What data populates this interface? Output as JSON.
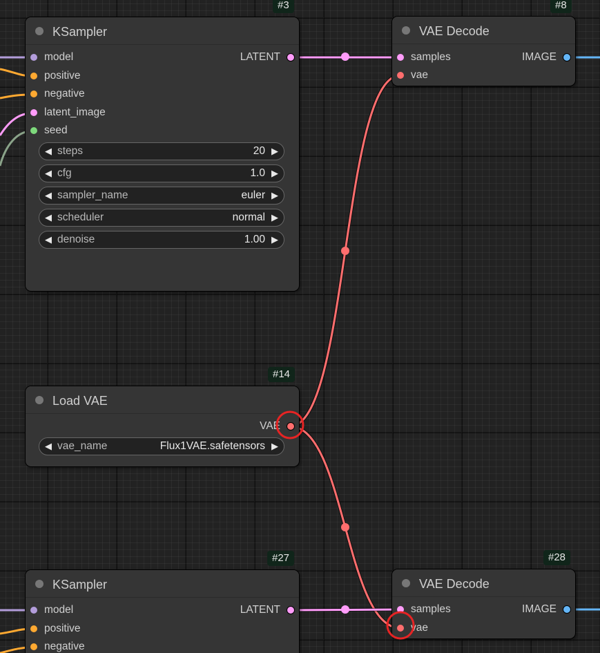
{
  "colors": {
    "background": "#222222",
    "node_body": "#353535",
    "node_id_badge": "#10251a",
    "model": "#b39ddb",
    "conditioning": "#ffa931",
    "latent": "#ff9cf9",
    "int": "#7ed97c",
    "vae": "#ff6e6e",
    "image": "#64b5f6",
    "highlight": "#e62424",
    "seed_link": "#8aa389"
  },
  "nodes": {
    "ksampler_3": {
      "id_label": "#3",
      "title": "KSampler",
      "inputs": [
        {
          "label": "model",
          "type": "MODEL"
        },
        {
          "label": "positive",
          "type": "CONDITIONING"
        },
        {
          "label": "negative",
          "type": "CONDITIONING"
        },
        {
          "label": "latent_image",
          "type": "LATENT"
        },
        {
          "label": "seed",
          "type": "INT"
        }
      ],
      "outputs": [
        {
          "label": "LATENT",
          "type": "LATENT"
        }
      ],
      "widgets": [
        {
          "label": "steps",
          "value": "20"
        },
        {
          "label": "cfg",
          "value": "1.0"
        },
        {
          "label": "sampler_name",
          "value": "euler"
        },
        {
          "label": "scheduler",
          "value": "normal"
        },
        {
          "label": "denoise",
          "value": "1.00"
        }
      ]
    },
    "vae_decode_8": {
      "id_label": "#8",
      "title": "VAE Decode",
      "inputs": [
        {
          "label": "samples",
          "type": "LATENT"
        },
        {
          "label": "vae",
          "type": "VAE"
        }
      ],
      "outputs": [
        {
          "label": "IMAGE",
          "type": "IMAGE"
        }
      ]
    },
    "load_vae_14": {
      "id_label": "#14",
      "title": "Load VAE",
      "outputs": [
        {
          "label": "VAE",
          "type": "VAE"
        }
      ],
      "widgets": [
        {
          "label": "vae_name",
          "value": "Flux1VAE.safetensors"
        }
      ]
    },
    "ksampler_27": {
      "id_label": "#27",
      "title": "KSampler",
      "inputs": [
        {
          "label": "model",
          "type": "MODEL"
        },
        {
          "label": "positive",
          "type": "CONDITIONING"
        },
        {
          "label": "negative",
          "type": "CONDITIONING"
        }
      ],
      "outputs": [
        {
          "label": "LATENT",
          "type": "LATENT"
        }
      ]
    },
    "vae_decode_28": {
      "id_label": "#28",
      "title": "VAE Decode",
      "inputs": [
        {
          "label": "samples",
          "type": "LATENT"
        },
        {
          "label": "vae",
          "type": "VAE"
        }
      ],
      "outputs": [
        {
          "label": "IMAGE",
          "type": "IMAGE"
        }
      ]
    }
  },
  "widget_arrows": {
    "left": "◀",
    "right": "▶"
  },
  "links": [
    {
      "name": "link-3-latent-to-8-samples",
      "from": "#3 LATENT",
      "to": "#8 samples",
      "type": "LATENT"
    },
    {
      "name": "link-14-vae-to-8-vae",
      "from": "#14 VAE",
      "to": "#8 vae",
      "type": "VAE"
    },
    {
      "name": "link-14-vae-to-28-vae",
      "from": "#14 VAE",
      "to": "#28 vae",
      "type": "VAE"
    },
    {
      "name": "link-27-latent-to-28-samples",
      "from": "#27 LATENT",
      "to": "#28 samples",
      "type": "LATENT"
    }
  ],
  "highlighted_slots": [
    "#14 VAE output",
    "#28 vae input"
  ]
}
